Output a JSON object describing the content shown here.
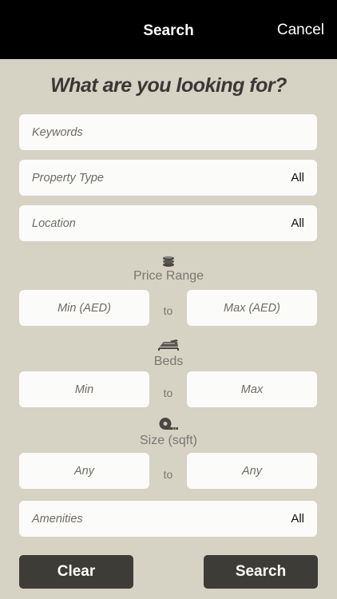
{
  "navbar": {
    "title": "Search",
    "cancel_label": "Cancel"
  },
  "heading": "What are you looking for?",
  "keywords": {
    "placeholder": "Keywords"
  },
  "property_type": {
    "label": "Property Type",
    "value": "All"
  },
  "location": {
    "label": "Location",
    "value": "All"
  },
  "price_range": {
    "label": "Price Range",
    "icon": "coins-stack-icon",
    "min_placeholder": "Min (AED)",
    "separator": "to",
    "max_placeholder": "Max (AED)"
  },
  "beds": {
    "label": "Beds",
    "icon": "bed-icon",
    "min_placeholder": "Min",
    "separator": "to",
    "max_placeholder": "Max"
  },
  "size": {
    "label": "Size (sqft)",
    "icon": "tape-measure-icon",
    "min_placeholder": "Any",
    "separator": "to",
    "max_placeholder": "Any"
  },
  "amenities": {
    "label": "Amenities",
    "value": "All"
  },
  "buttons": {
    "clear_label": "Clear",
    "search_label": "Search"
  },
  "colors": {
    "background": "#d6d2c4",
    "navbar": "#000000",
    "field": "#fbfbf9",
    "button": "#3e3c36"
  }
}
